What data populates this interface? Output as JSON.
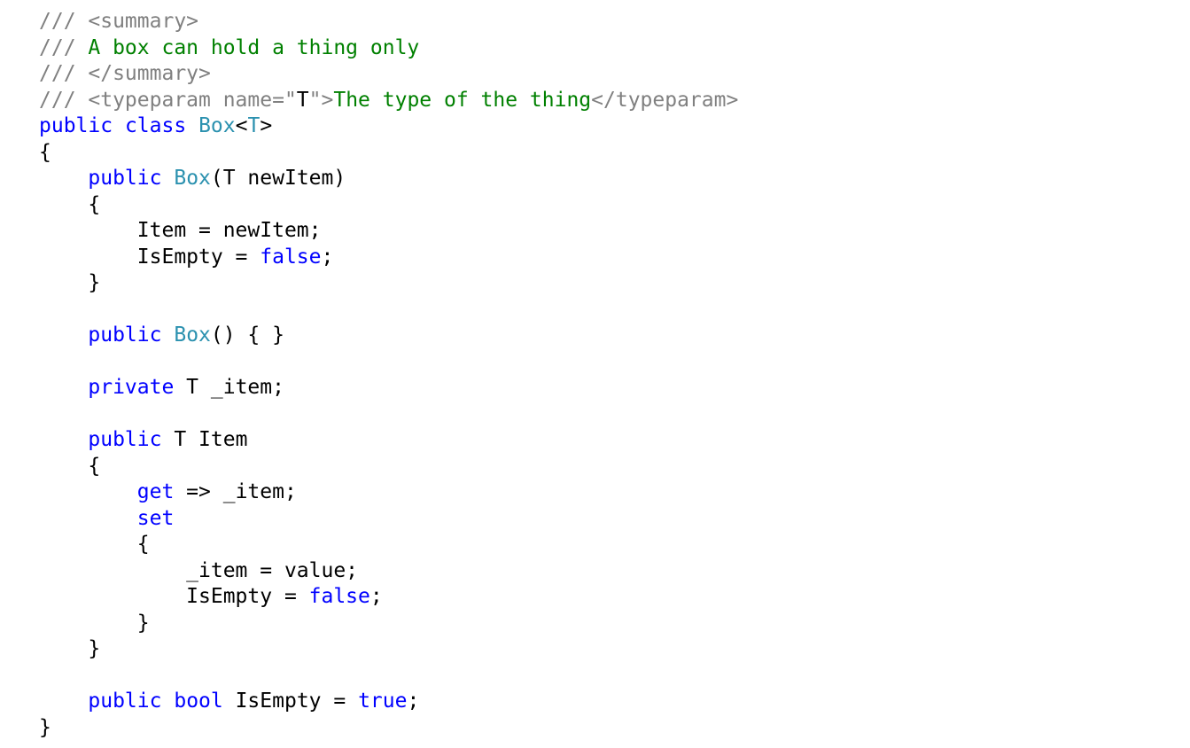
{
  "colors": {
    "background": "#ffffff",
    "comment": "#808080",
    "doc_text": "#008000",
    "keyword": "#0000ff",
    "type": "#2b91af",
    "plain": "#000000"
  },
  "code": {
    "lines": [
      [
        {
          "t": "/// ",
          "c": "comment"
        },
        {
          "t": "<summary>",
          "c": "xmltag"
        }
      ],
      [
        {
          "t": "/// ",
          "c": "comment"
        },
        {
          "t": "A box can hold a thing only",
          "c": "doctext"
        }
      ],
      [
        {
          "t": "/// ",
          "c": "comment"
        },
        {
          "t": "</summary>",
          "c": "xmltag"
        }
      ],
      [
        {
          "t": "/// ",
          "c": "comment"
        },
        {
          "t": "<typeparam name=\"",
          "c": "xmltag"
        },
        {
          "t": "T",
          "c": "plain"
        },
        {
          "t": "\">",
          "c": "xmltag"
        },
        {
          "t": "The type of the thing",
          "c": "doctext"
        },
        {
          "t": "</typeparam>",
          "c": "xmltag"
        }
      ],
      [
        {
          "t": "public",
          "c": "keyword"
        },
        {
          "t": " ",
          "c": "plain"
        },
        {
          "t": "class",
          "c": "keyword"
        },
        {
          "t": " ",
          "c": "plain"
        },
        {
          "t": "Box",
          "c": "type"
        },
        {
          "t": "<",
          "c": "plain"
        },
        {
          "t": "T",
          "c": "type"
        },
        {
          "t": ">",
          "c": "plain"
        }
      ],
      [
        {
          "t": "{",
          "c": "plain"
        }
      ],
      [
        {
          "t": "    ",
          "c": "plain"
        },
        {
          "t": "public",
          "c": "keyword"
        },
        {
          "t": " ",
          "c": "plain"
        },
        {
          "t": "Box",
          "c": "type"
        },
        {
          "t": "(T newItem)",
          "c": "plain"
        }
      ],
      [
        {
          "t": "    {",
          "c": "plain"
        }
      ],
      [
        {
          "t": "        Item = newItem;",
          "c": "plain"
        }
      ],
      [
        {
          "t": "        IsEmpty = ",
          "c": "plain"
        },
        {
          "t": "false",
          "c": "keyword"
        },
        {
          "t": ";",
          "c": "plain"
        }
      ],
      [
        {
          "t": "    }",
          "c": "plain"
        }
      ],
      [],
      [
        {
          "t": "    ",
          "c": "plain"
        },
        {
          "t": "public",
          "c": "keyword"
        },
        {
          "t": " ",
          "c": "plain"
        },
        {
          "t": "Box",
          "c": "type"
        },
        {
          "t": "() { }",
          "c": "plain"
        }
      ],
      [],
      [
        {
          "t": "    ",
          "c": "plain"
        },
        {
          "t": "private",
          "c": "keyword"
        },
        {
          "t": " T _item;",
          "c": "plain"
        }
      ],
      [],
      [
        {
          "t": "    ",
          "c": "plain"
        },
        {
          "t": "public",
          "c": "keyword"
        },
        {
          "t": " T Item",
          "c": "plain"
        }
      ],
      [
        {
          "t": "    {",
          "c": "plain"
        }
      ],
      [
        {
          "t": "        ",
          "c": "plain"
        },
        {
          "t": "get",
          "c": "keyword"
        },
        {
          "t": " => _item;",
          "c": "plain"
        }
      ],
      [
        {
          "t": "        ",
          "c": "plain"
        },
        {
          "t": "set",
          "c": "keyword"
        }
      ],
      [
        {
          "t": "        {",
          "c": "plain"
        }
      ],
      [
        {
          "t": "            _item = value;",
          "c": "plain"
        }
      ],
      [
        {
          "t": "            IsEmpty = ",
          "c": "plain"
        },
        {
          "t": "false",
          "c": "keyword"
        },
        {
          "t": ";",
          "c": "plain"
        }
      ],
      [
        {
          "t": "        }",
          "c": "plain"
        }
      ],
      [
        {
          "t": "    }",
          "c": "plain"
        }
      ],
      [],
      [
        {
          "t": "    ",
          "c": "plain"
        },
        {
          "t": "public",
          "c": "keyword"
        },
        {
          "t": " ",
          "c": "plain"
        },
        {
          "t": "bool",
          "c": "keyword"
        },
        {
          "t": " IsEmpty = ",
          "c": "plain"
        },
        {
          "t": "true",
          "c": "keyword"
        },
        {
          "t": ";",
          "c": "plain"
        }
      ],
      [
        {
          "t": "}",
          "c": "plain"
        }
      ]
    ]
  }
}
